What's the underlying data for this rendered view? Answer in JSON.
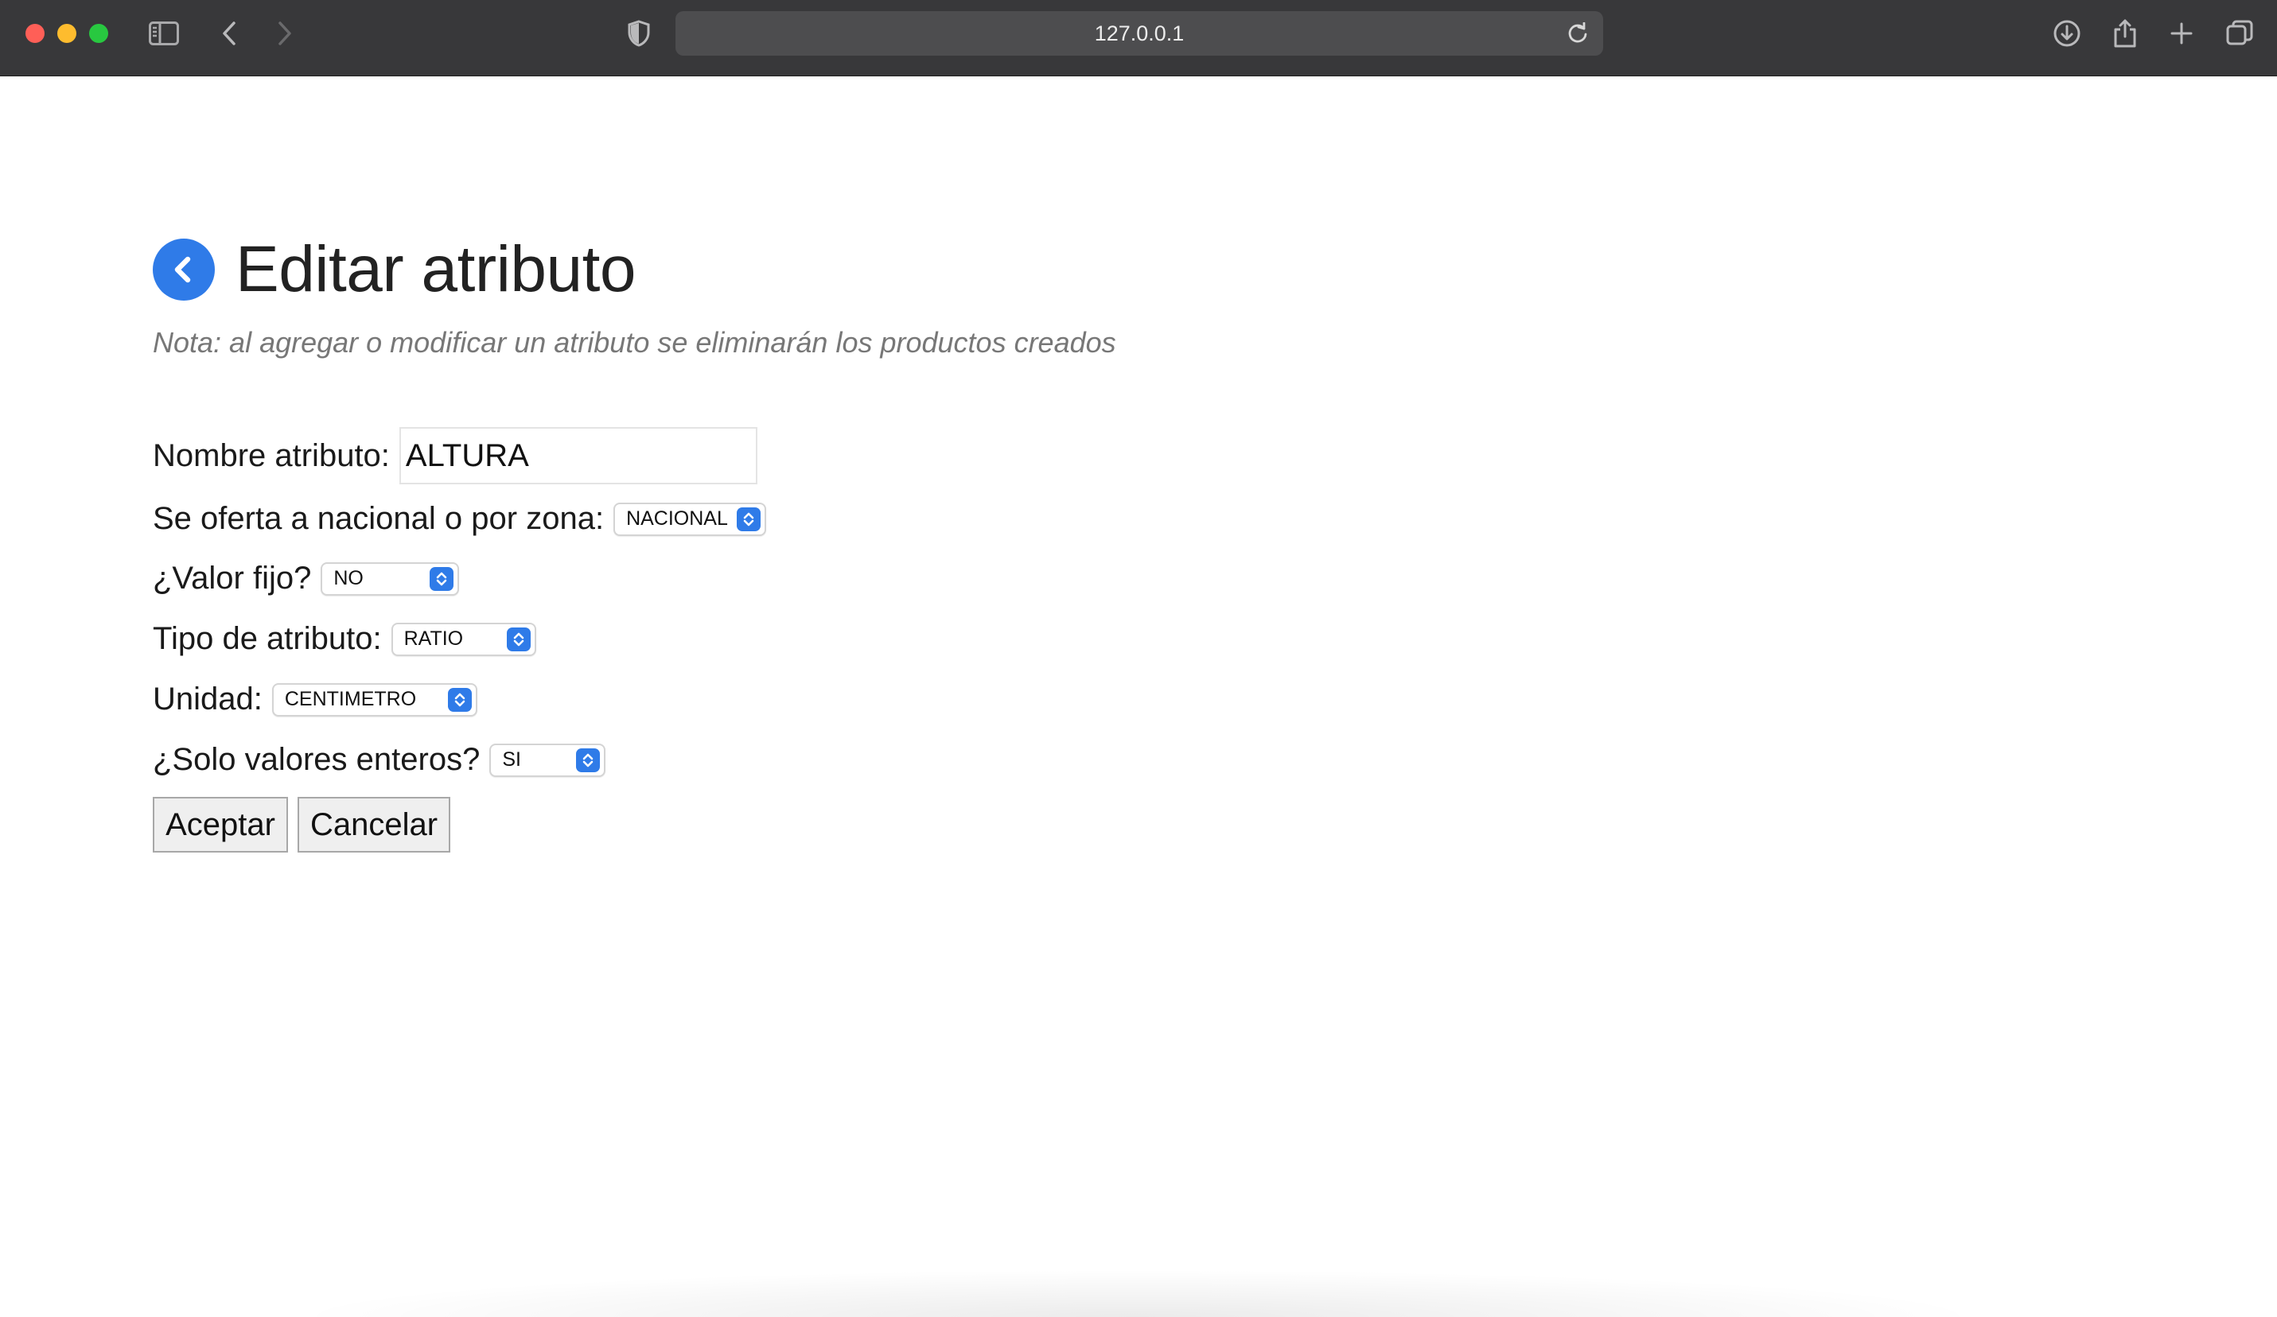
{
  "browser": {
    "url": "127.0.0.1"
  },
  "page": {
    "title": "Editar atributo",
    "note": "Nota: al agregar o modificar un atributo se eliminarán los productos creados"
  },
  "form": {
    "nombre": {
      "label": "Nombre atributo:",
      "value": "ALTURA"
    },
    "oferta": {
      "label": "Se oferta a nacional o por zona:",
      "value": "NACIONAL"
    },
    "valor_fijo": {
      "label": "¿Valor fijo?",
      "value": "NO"
    },
    "tipo": {
      "label": "Tipo de atributo:",
      "value": "RATIO"
    },
    "unidad": {
      "label": "Unidad:",
      "value": "CENTIMETRO"
    },
    "enteros": {
      "label": "¿Solo valores enteros?",
      "value": "SI"
    }
  },
  "buttons": {
    "accept": "Aceptar",
    "cancel": "Cancelar"
  },
  "colors": {
    "accent": "#2f7be8",
    "toolbar": "#38383a"
  }
}
